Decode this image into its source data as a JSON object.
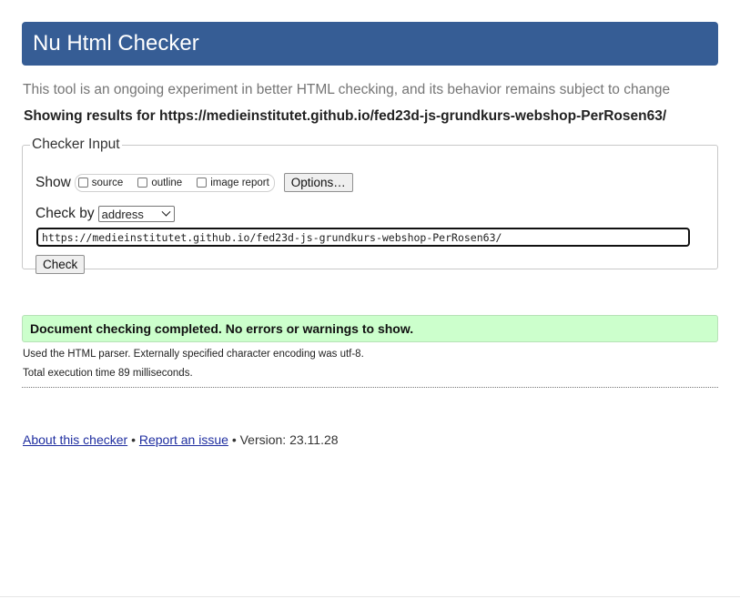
{
  "header": {
    "title": "Nu Html Checker"
  },
  "tagline": "This tool is an ongoing experiment in better HTML checking, and its behavior remains subject to change",
  "showing_results": "Showing results for https://medieinstitutet.github.io/fed23d-js-grundkurs-webshop-PerRosen63/",
  "checker_input": {
    "legend": "Checker Input",
    "show_label": "Show",
    "show_options": [
      {
        "label": "source",
        "checked": false
      },
      {
        "label": "outline",
        "checked": false
      },
      {
        "label": "image report",
        "checked": false
      }
    ],
    "options_button": "Options…",
    "check_by_label": "Check by",
    "check_by_selected": "address",
    "url_value": "https://medieinstitutet.github.io/fed23d-js-grundkurs-webshop-PerRosen63/",
    "check_button": "Check"
  },
  "result": {
    "message": "Document checking completed. No errors or warnings to show.",
    "color": "#ccffcc",
    "parser_info": "Used the HTML parser. Externally specified character encoding was utf-8.",
    "execution_time": "Total execution time 89 milliseconds."
  },
  "footer": {
    "about_link": "About this checker",
    "separator": "•",
    "report_link": "Report an issue",
    "version": "Version: 23.11.28"
  },
  "colors": {
    "title_bar": "#365d95",
    "link": "#1f2ea0"
  }
}
